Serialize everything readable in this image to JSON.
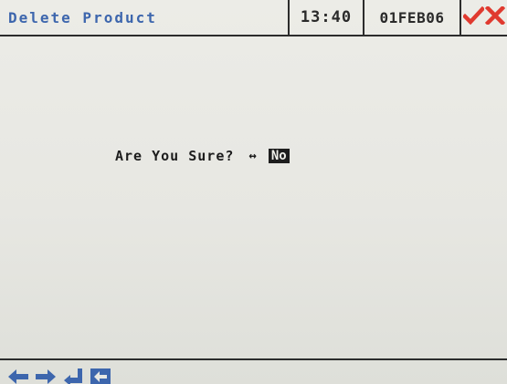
{
  "header": {
    "title": "Delete Product",
    "time": "13:40",
    "date": "01FEB06",
    "accept_icon": "check-icon",
    "cancel_icon": "x-icon"
  },
  "dialog": {
    "prompt": "Are You Sure?",
    "toggle_icon": "left-right-arrow-icon",
    "answer": "No"
  },
  "footer": {
    "icons": [
      "arrow-left-icon",
      "arrow-right-icon",
      "enter-icon",
      "backspace-icon"
    ]
  },
  "colors": {
    "accent_blue": "#3d66ad",
    "accept_red": "#e03a2f",
    "background": "#e8e8e3",
    "text": "#1d1d1d"
  }
}
